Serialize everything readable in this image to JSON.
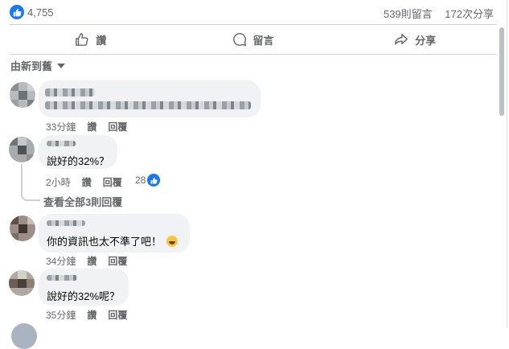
{
  "summary": {
    "like_count": "4,755",
    "comments": "539則留言",
    "shares": "172次分享"
  },
  "actions": {
    "like": "讚",
    "comment": "留言",
    "share": "分享"
  },
  "sort": {
    "label": "由新到舊"
  },
  "comments": [
    {
      "text": "",
      "time": "33分鐘",
      "like": "讚",
      "reply": "回覆"
    },
    {
      "text": "說好的32%？",
      "time": "2小時",
      "like": "讚",
      "reply": "回覆",
      "reactions": "28",
      "view_replies": "查看全部3則回覆"
    },
    {
      "text": "你的資訊也太不準了吧！",
      "time": "34分鐘",
      "like": "讚",
      "reply": "回覆"
    },
    {
      "text": "說好的32%呢？",
      "time": "35分鐘",
      "like": "讚",
      "reply": "回覆"
    }
  ],
  "colors": {
    "accent": "#1877f2",
    "bubble": "#f0f2f5",
    "secondary_text": "#65676b"
  },
  "icons": {
    "like": "thumbs-up-icon",
    "comment": "speech-bubble-icon",
    "share": "share-arrow-icon",
    "sort": "caret-down-icon"
  }
}
